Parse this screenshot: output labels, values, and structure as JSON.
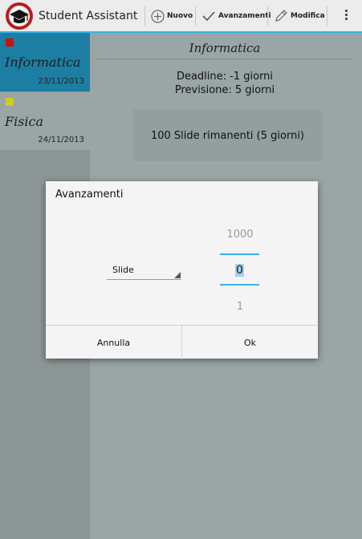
{
  "app": {
    "title": "Student Assistant",
    "icon": "graduation-cap-icon"
  },
  "actionbar": {
    "actions": [
      {
        "label": "Nuovo",
        "icon": "add-circle-icon"
      },
      {
        "label": "Avanzamenti",
        "icon": "checkmark-icon"
      },
      {
        "label": "Modifica",
        "icon": "pencil-icon"
      }
    ],
    "overflow_icon": "overflow-menu-icon"
  },
  "sidebar": {
    "items": [
      {
        "name": "Informatica",
        "date": "23/11/2013",
        "color": "#cc1111",
        "selected": true
      },
      {
        "name": "Fisica",
        "date": "24/11/2013",
        "color": "#cccc22",
        "selected": false
      }
    ]
  },
  "detail": {
    "title": "Informatica",
    "deadline": "Deadline: -1 giorni",
    "previsione": "Previsione: 5 giorni",
    "remaining": "100 Slide rimanenti (5 giorni)"
  },
  "dialog": {
    "title": "Avanzamenti",
    "unit_spinner": {
      "selected": "Slide"
    },
    "number_picker": {
      "previous": "1000",
      "current": "0",
      "next": "1"
    },
    "buttons": {
      "cancel": "Annulla",
      "ok": "Ok"
    }
  },
  "colors": {
    "accent": "#33b5e5",
    "selected_item": "#1c7ea2"
  }
}
